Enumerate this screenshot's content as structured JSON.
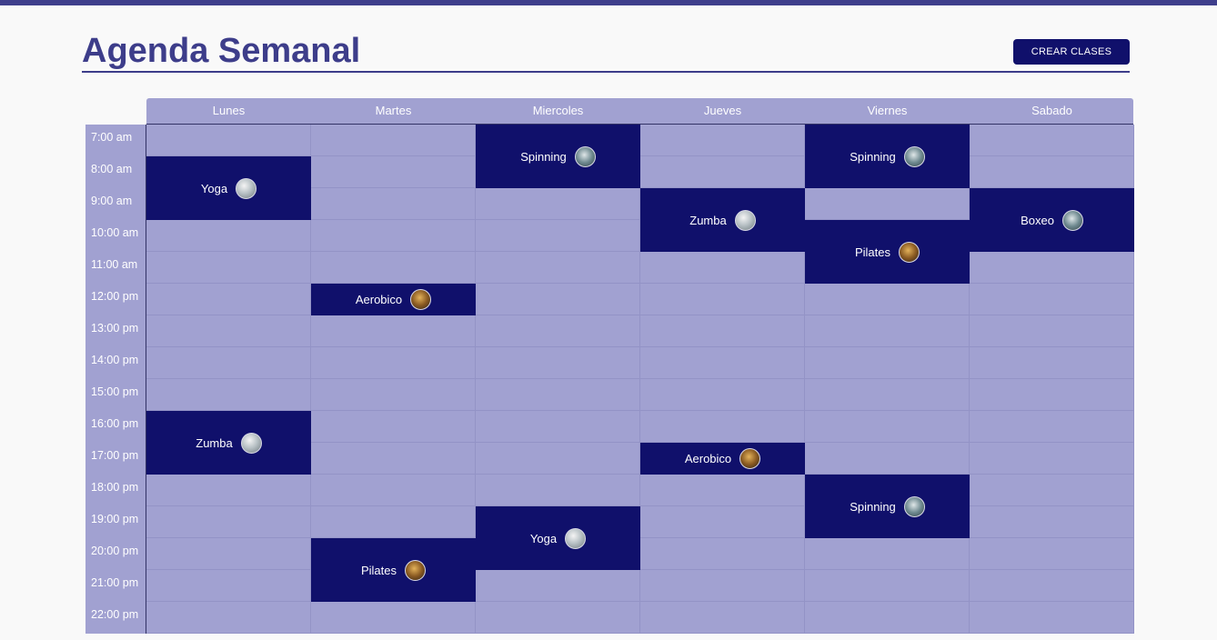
{
  "header": {
    "title": "Agenda Semanal",
    "create_button_label": "CREAR CLASES"
  },
  "days": [
    "Lunes",
    "Martes",
    "Miercoles",
    "Jueves",
    "Viernes",
    "Sabado"
  ],
  "times": [
    "7:00 am",
    "8:00 am",
    "9:00 am",
    "10:00 am",
    "11:00 am",
    "12:00 pm",
    "13:00 pm",
    "14:00 pm",
    "15:00 pm",
    "16:00 pm",
    "17:00 pm",
    "18:00 pm",
    "19:00 pm",
    "20:00 pm",
    "21:00 pm",
    "22:00 pm"
  ],
  "events": [
    {
      "day": 0,
      "start": 1,
      "span": 2,
      "name": "Yoga",
      "avatar": "silver-instructor-icon"
    },
    {
      "day": 0,
      "start": 9,
      "span": 2,
      "name": "Zumba",
      "avatar": "silver-instructor-icon"
    },
    {
      "day": 1,
      "start": 5,
      "span": 1,
      "name": "Aerobico",
      "avatar": "gold-instructor-icon"
    },
    {
      "day": 1,
      "start": 13,
      "span": 2,
      "name": "Pilates",
      "avatar": "gold-instructor-icon"
    },
    {
      "day": 2,
      "start": 0,
      "span": 2,
      "name": "Spinning",
      "avatar": "grey-instructor-icon"
    },
    {
      "day": 2,
      "start": 12,
      "span": 2,
      "name": "Yoga",
      "avatar": "silver-instructor-icon"
    },
    {
      "day": 3,
      "start": 2,
      "span": 2,
      "name": "Zumba",
      "avatar": "silver-instructor-icon"
    },
    {
      "day": 3,
      "start": 10,
      "span": 1,
      "name": "Aerobico",
      "avatar": "gold-instructor-icon"
    },
    {
      "day": 4,
      "start": 0,
      "span": 2,
      "name": "Spinning",
      "avatar": "grey-instructor-icon"
    },
    {
      "day": 4,
      "start": 3,
      "span": 2,
      "name": "Pilates",
      "avatar": "gold-instructor-icon"
    },
    {
      "day": 4,
      "start": 11,
      "span": 2,
      "name": "Spinning",
      "avatar": "grey-instructor-icon"
    },
    {
      "day": 5,
      "start": 2,
      "span": 2,
      "name": "Boxeo",
      "avatar": "grey-instructor-icon"
    }
  ],
  "colors": {
    "accent": "#3d3d8a",
    "event": "#10106b",
    "grid": "#a1a1d1"
  }
}
